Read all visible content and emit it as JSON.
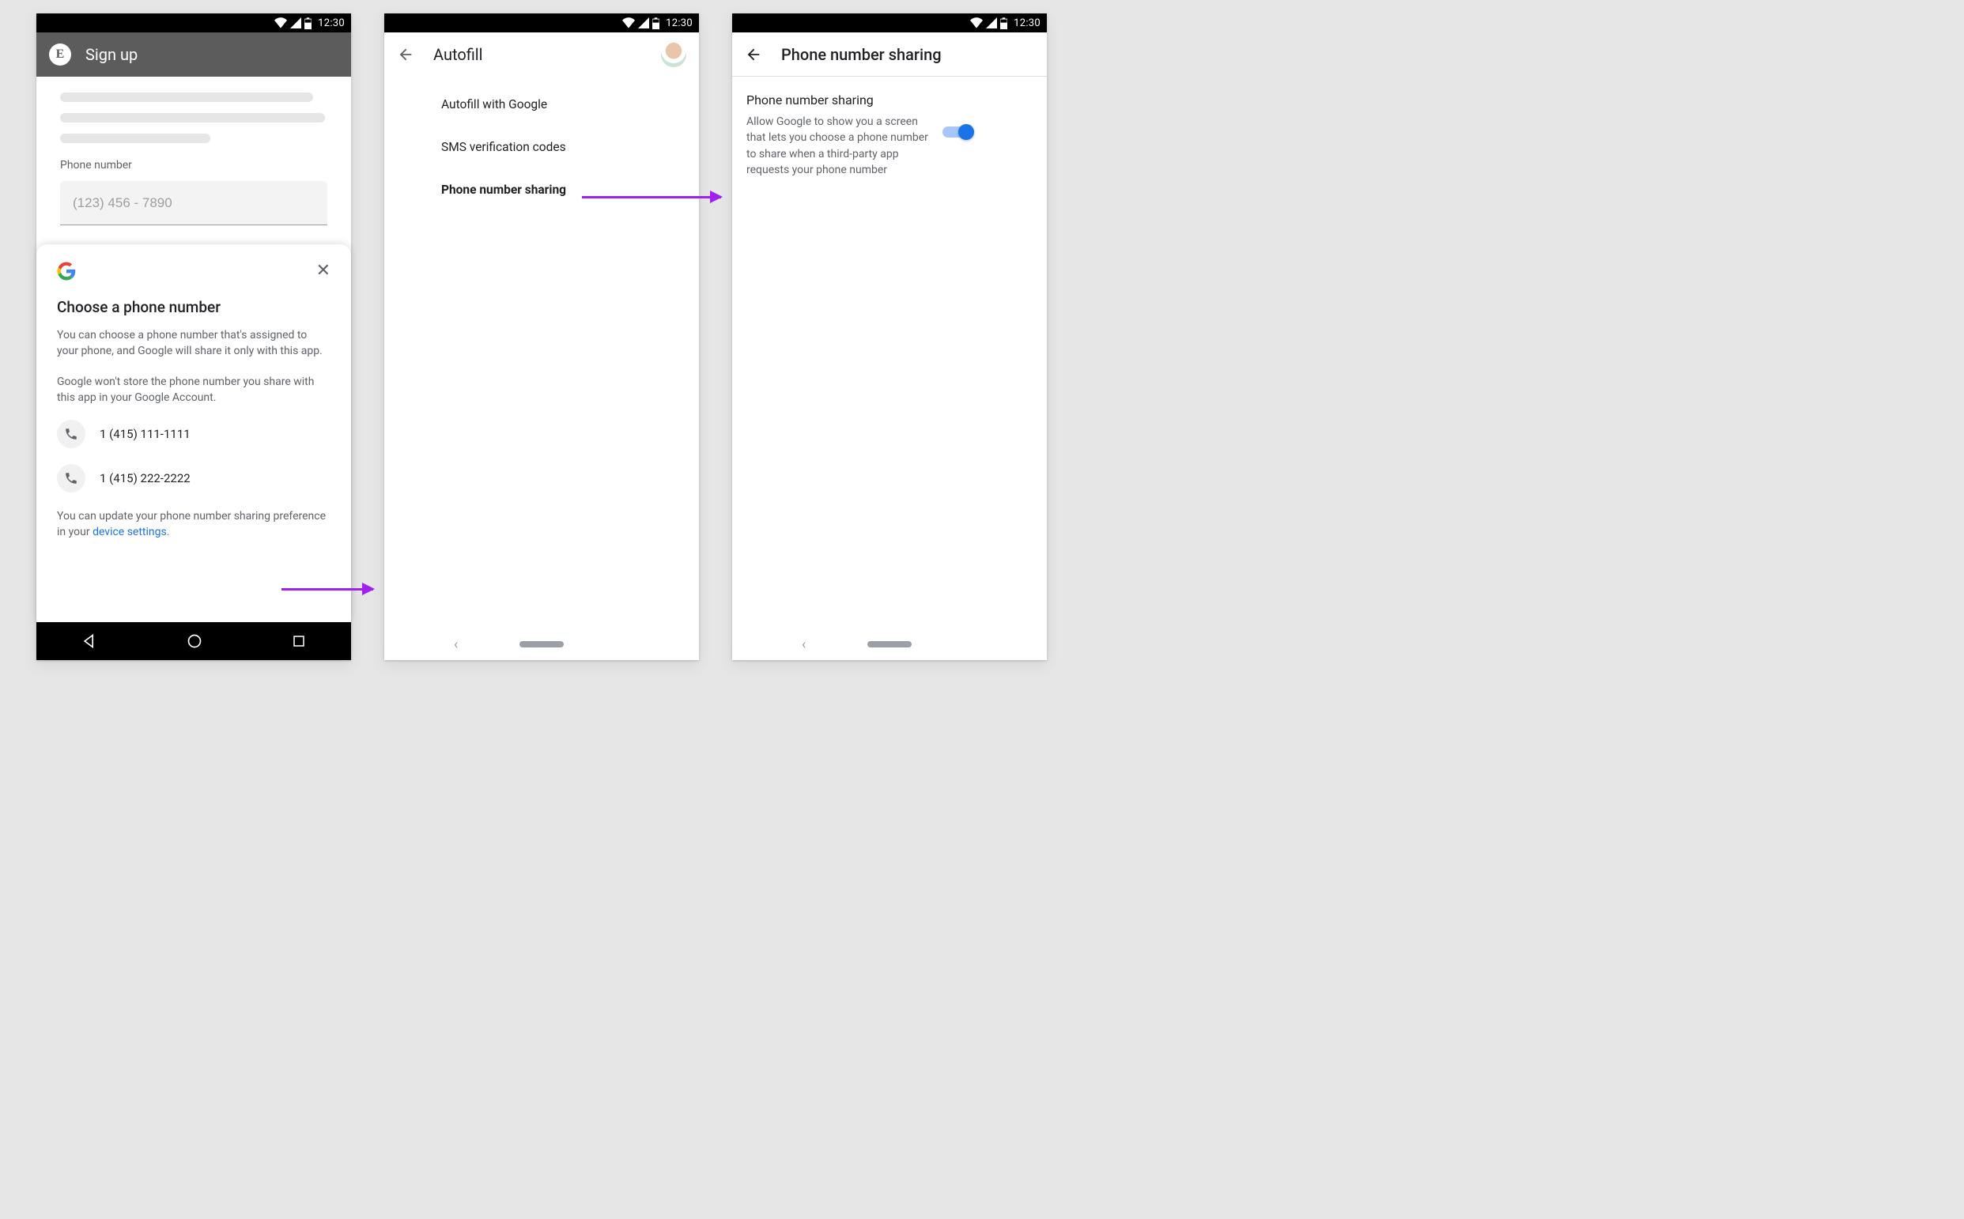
{
  "status": {
    "time": "12:30"
  },
  "screen1": {
    "appbar_title": "Sign up",
    "app_letter": "E",
    "field_label": "Phone number",
    "placeholder": "(123) 456 - 7890",
    "sheet": {
      "title": "Choose a phone number",
      "para1": "You can choose a phone number that's assigned to your phone, and Google will share it only with this app.",
      "para2": "Google won't store the phone number you share with this app in your Google Account.",
      "phones": [
        "1 (415) 111-1111",
        "1 (415) 222-2222"
      ],
      "footer_pre": "You can update your phone number sharing preference in your ",
      "footer_link": "device settings",
      "footer_post": "."
    }
  },
  "screen2": {
    "title": "Autofill",
    "items": [
      "Autofill with Google",
      "SMS verification codes",
      "Phone number sharing"
    ]
  },
  "screen3": {
    "title": "Phone number sharing",
    "row": {
      "title": "Phone number sharing",
      "desc": "Allow Google to show you a screen that lets you choose a phone number to share when a third-party app requests your phone number"
    }
  }
}
